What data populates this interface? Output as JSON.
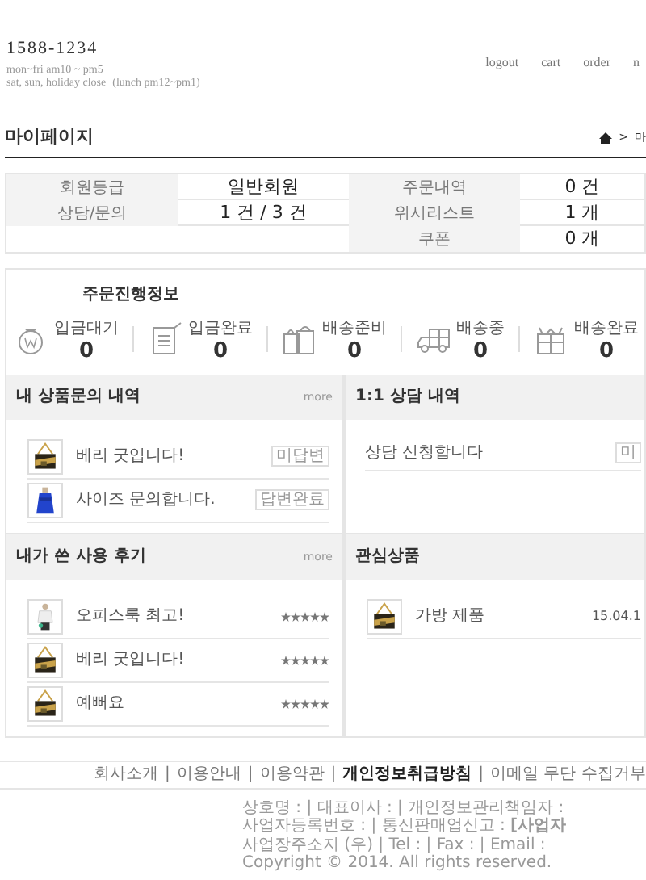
{
  "contact": {
    "phone": "1588-1234",
    "hours": "mon~fri am10 ~ pm5",
    "closed": "sat, sun, holiday close",
    "lunch": "(lunch pm12~pm1)"
  },
  "top_menu": [
    "logout",
    "cart",
    "order",
    "n"
  ],
  "page_title": "마이페이지",
  "breadcrumb": {
    "separator": ">",
    "current": "마"
  },
  "summary": [
    {
      "label": "회원등급",
      "value": "일반회원",
      "label_2": "주문내역",
      "value_2": "0 건"
    },
    {
      "label": "상담/문의",
      "value": "1 건 / 3 건",
      "label_2": "위시리스트",
      "value_2": "1 개"
    },
    {
      "label_2": "쿠폰",
      "value_2": "0 개"
    }
  ],
  "order_status": {
    "title": "주문진행정보",
    "steps": [
      {
        "kind": "money",
        "label": "입금대기",
        "count": "0"
      },
      {
        "kind": "note",
        "label": "입금완료",
        "count": "0"
      },
      {
        "kind": "bags",
        "label": "배송준비",
        "count": "0"
      },
      {
        "kind": "truck",
        "label": "배송중",
        "count": "0"
      },
      {
        "kind": "gift",
        "label": "배송완료",
        "count": "0"
      }
    ]
  },
  "inquiries": {
    "title": "내 상품문의 내역",
    "more": "more",
    "items": [
      {
        "kind": "picture",
        "text": "베리 굿입니다!",
        "status": "미답변"
      },
      {
        "kind": "picture",
        "text": "사이즈 문의합니다.",
        "status": "답변완료"
      }
    ]
  },
  "consult": {
    "title": "1:1 상담 내역",
    "items": [
      {
        "text": "상담 신청합니다",
        "status": "미"
      }
    ]
  },
  "reviews": {
    "title": "내가 쓴 사용 후기",
    "more": "more",
    "items": [
      {
        "kind": "picture",
        "text": "오피스룩 최고!",
        "stars": 5
      },
      {
        "kind": "picture",
        "text": "베리 굿입니다!",
        "stars": 5
      },
      {
        "kind": "picture",
        "text": "예뻐요",
        "stars": 5
      }
    ]
  },
  "wishlist": {
    "title": "관심상품",
    "items": [
      {
        "kind": "picture",
        "text": "가방 제품",
        "date": "15.04.1"
      }
    ]
  },
  "footer_links": [
    {
      "text": "회사소개",
      "bold": false
    },
    {
      "separator": "|",
      "text": "이용안내",
      "bold": false
    },
    {
      "separator": "|",
      "text": "이용약관",
      "bold": false
    },
    {
      "separator": "|",
      "text": "개인정보취급방침",
      "bold": true
    },
    {
      "separator": "|",
      "text": "이메일 무단 수집거부",
      "bold": false
    }
  ],
  "company_info": [
    "상호명 : | 대표이사 : | 개인정보관리책임자 :",
    "사업자등록번호 : | 통신판매업신고 :  **[사업자**",
    "사업장주소지 (우) | Tel : | Fax : | Email :",
    "Copyright © 2014. All rights reserved."
  ]
}
